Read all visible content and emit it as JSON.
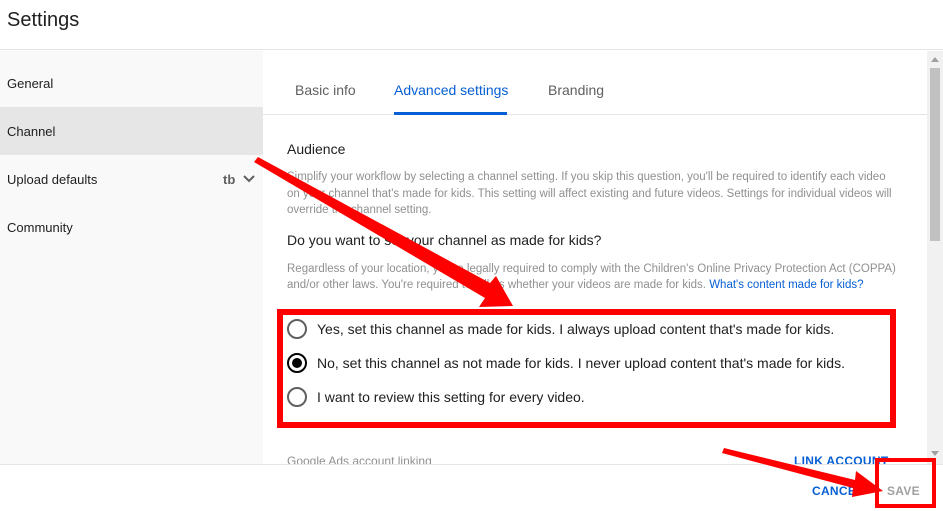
{
  "header": {
    "title": "Settings"
  },
  "sidebar": {
    "items": [
      {
        "label": "General"
      },
      {
        "label": "Channel"
      },
      {
        "label": "Upload defaults"
      },
      {
        "label": "Community"
      }
    ],
    "upload_icons": [
      "beta-icon",
      "chevron-down-icon"
    ]
  },
  "tabs": [
    {
      "label": "Basic info"
    },
    {
      "label": "Advanced settings"
    },
    {
      "label": "Branding"
    }
  ],
  "audience": {
    "title": "Audience",
    "description": "Simplify your workflow by selecting a channel setting. If you skip this question, you'll be required to identify each video on your channel that's made for kids. This setting will affect existing and future videos. Settings for individual videos will override the channel setting.",
    "question": "Do you want to set your channel as made for kids?",
    "note": "Regardless of your location, you're legally required to comply with the Children's Online Privacy Protection Act (COPPA) and/or other laws. You're required to tell us whether your videos are made for kids.",
    "note_link": "What's content made for kids?",
    "options": [
      {
        "label": "Yes, set this channel as made for kids. I always upload content that's made for kids.",
        "checked": false
      },
      {
        "label": "No, set this channel as not made for kids. I never upload content that's made for kids.",
        "checked": true
      },
      {
        "label": "I want to review this setting for every video.",
        "checked": false
      }
    ]
  },
  "ads": {
    "label": "Google Ads account linking",
    "link_label": "LINK ACCOUNT"
  },
  "footer": {
    "cancel_label": "CANCEL",
    "save_label": "SAVE"
  },
  "colors": {
    "accent": "#065fd4",
    "annotation": "#ff0000"
  }
}
